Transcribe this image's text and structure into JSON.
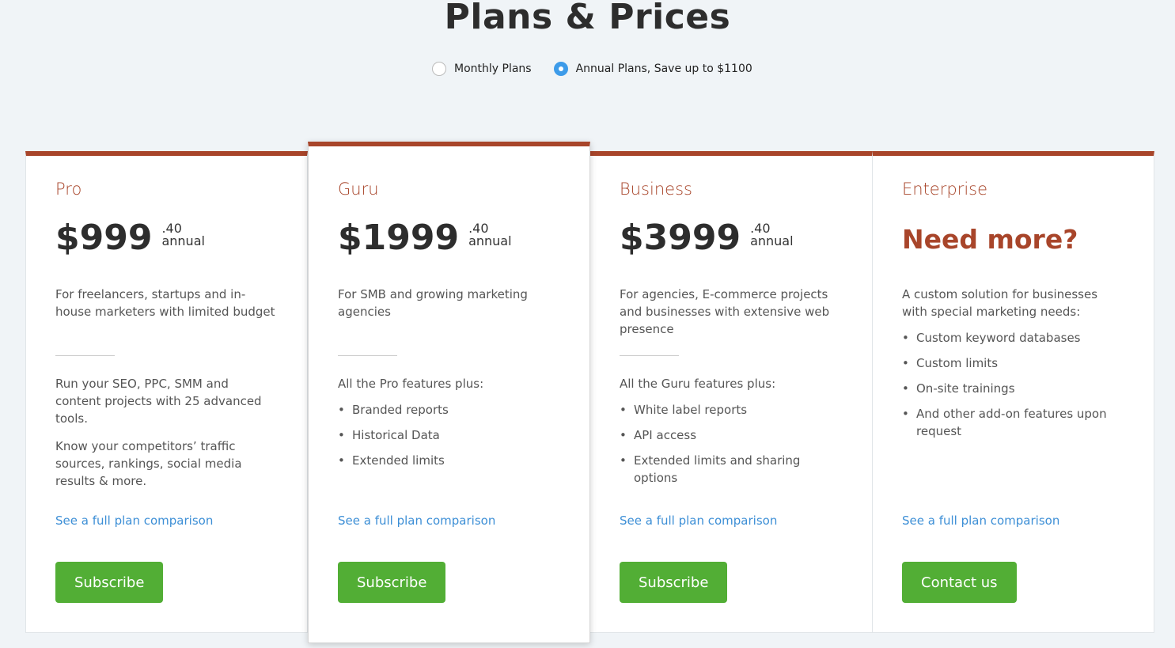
{
  "header": {
    "title": "Plans & Prices"
  },
  "billing_toggle": {
    "options": [
      {
        "label": "Monthly Plans",
        "selected": false
      },
      {
        "label": "Annual Plans, Save up to $1100",
        "selected": true
      }
    ]
  },
  "colors": {
    "accent": "#a8452a",
    "cta": "#52ae35",
    "link": "#3d8fd6",
    "radio_selected": "#3d9be9"
  },
  "plans": [
    {
      "name": "Pro",
      "price": "$999",
      "cents": ".40",
      "period": "annual",
      "description": "For freelancers, startups and in-house marketers with limited budget",
      "paragraphs": [
        "Run your SEO, PPC, SMM and content projects with 25 advanced tools.",
        "Know your competitors’ traffic sources, rankings, social media results & more."
      ],
      "compare_link": "See a full plan comparison",
      "cta": "Subscribe"
    },
    {
      "name": "Guru",
      "price": "$1999",
      "cents": ".40",
      "period": "annual",
      "description": "For SMB and growing marketing agencies",
      "features_intro": "All the Pro features plus:",
      "features": [
        "Branded reports",
        "Historical Data",
        "Extended limits"
      ],
      "compare_link": "See a full plan comparison",
      "cta": "Subscribe",
      "highlighted": true
    },
    {
      "name": "Business",
      "price": "$3999",
      "cents": ".40",
      "period": "annual",
      "description": "For agencies, E-commerce projects and businesses with extensive web presence",
      "features_intro": "All the Guru features plus:",
      "features": [
        "White label reports",
        "API access",
        "Extended limits and sharing options"
      ],
      "compare_link": "See a full plan comparison",
      "cta": "Subscribe"
    },
    {
      "name": "Enterprise",
      "headline": "Need more?",
      "description": "A custom solution for businesses with special marketing needs:",
      "features": [
        "Custom keyword databases",
        "Custom limits",
        "On-site trainings",
        "And other add-on features upon request"
      ],
      "compare_link": "See a full plan comparison",
      "cta": "Contact us"
    }
  ]
}
